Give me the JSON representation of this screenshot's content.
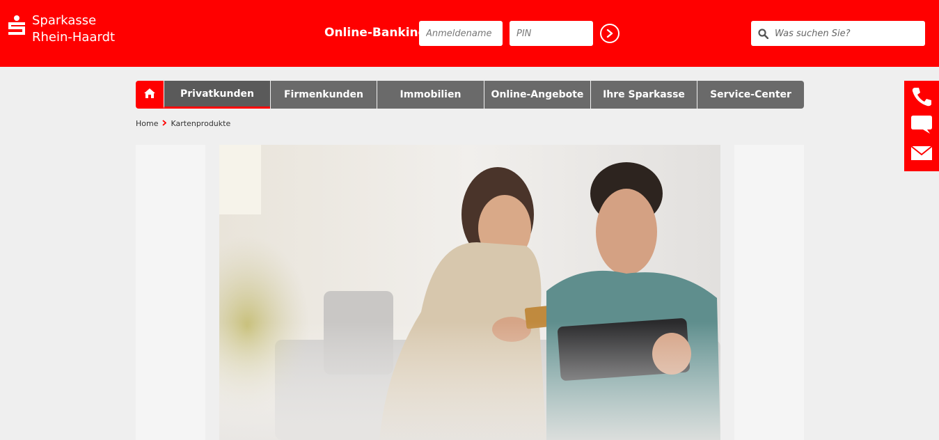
{
  "brand": {
    "line1": "Sparkasse",
    "line2": "Rhein-Haardt",
    "color": "#ff0000"
  },
  "online_banking": {
    "label": "Online-Banking",
    "username_placeholder": "Anmeldename",
    "pin_placeholder": "PIN",
    "submit_icon": "chevron-right-icon"
  },
  "search": {
    "placeholder": "Was suchen Sie?",
    "icon": "search-icon"
  },
  "nav": {
    "home_icon": "home-icon",
    "items": [
      {
        "label": "Privatkunden",
        "active": true
      },
      {
        "label": "Firmenkunden",
        "active": false
      },
      {
        "label": "Immobilien",
        "active": false
      },
      {
        "label": "Online-Angebote",
        "active": false
      },
      {
        "label": "Ihre Sparkasse",
        "active": false
      },
      {
        "label": "Service-Center",
        "active": false
      }
    ]
  },
  "breadcrumb": {
    "items": [
      "Home",
      "Kartenprodukte"
    ]
  },
  "contact_bar": {
    "icons": [
      "phone-icon",
      "chat-icon",
      "mail-icon"
    ]
  }
}
